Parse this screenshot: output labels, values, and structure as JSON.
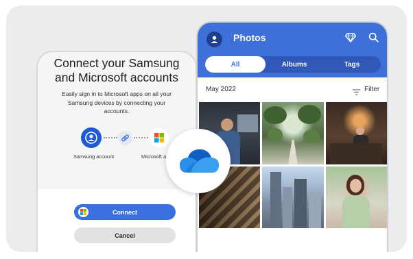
{
  "left_phone": {
    "title": "Connect your Samsung\nand Microsoft accounts",
    "description": "Easily sign in to Microsoft apps on all your\nSamsung devices by connecting your\naccounts.",
    "samsung_account_label": "Samsung account",
    "microsoft_account_label": "Microsoft a",
    "connect_label": "Connect",
    "cancel_label": "Cancel"
  },
  "right_phone": {
    "app_title": "Photos",
    "tabs": [
      {
        "label": "All",
        "active": true
      },
      {
        "label": "Albums",
        "active": false
      },
      {
        "label": "Tags",
        "active": false
      }
    ],
    "date_label": "May 2022",
    "filter_label": "Filter"
  },
  "icons": {
    "avatar": "avatar-icon",
    "premium": "diamond-icon",
    "search": "search-icon",
    "filter": "filter-icon",
    "link": "link-icon",
    "onedrive": "onedrive-cloud-icon"
  },
  "colors": {
    "brand_blue": "#3f6fd8",
    "connect_blue": "#3a6fe0",
    "onedrive_blue": "#1f7ee0"
  }
}
